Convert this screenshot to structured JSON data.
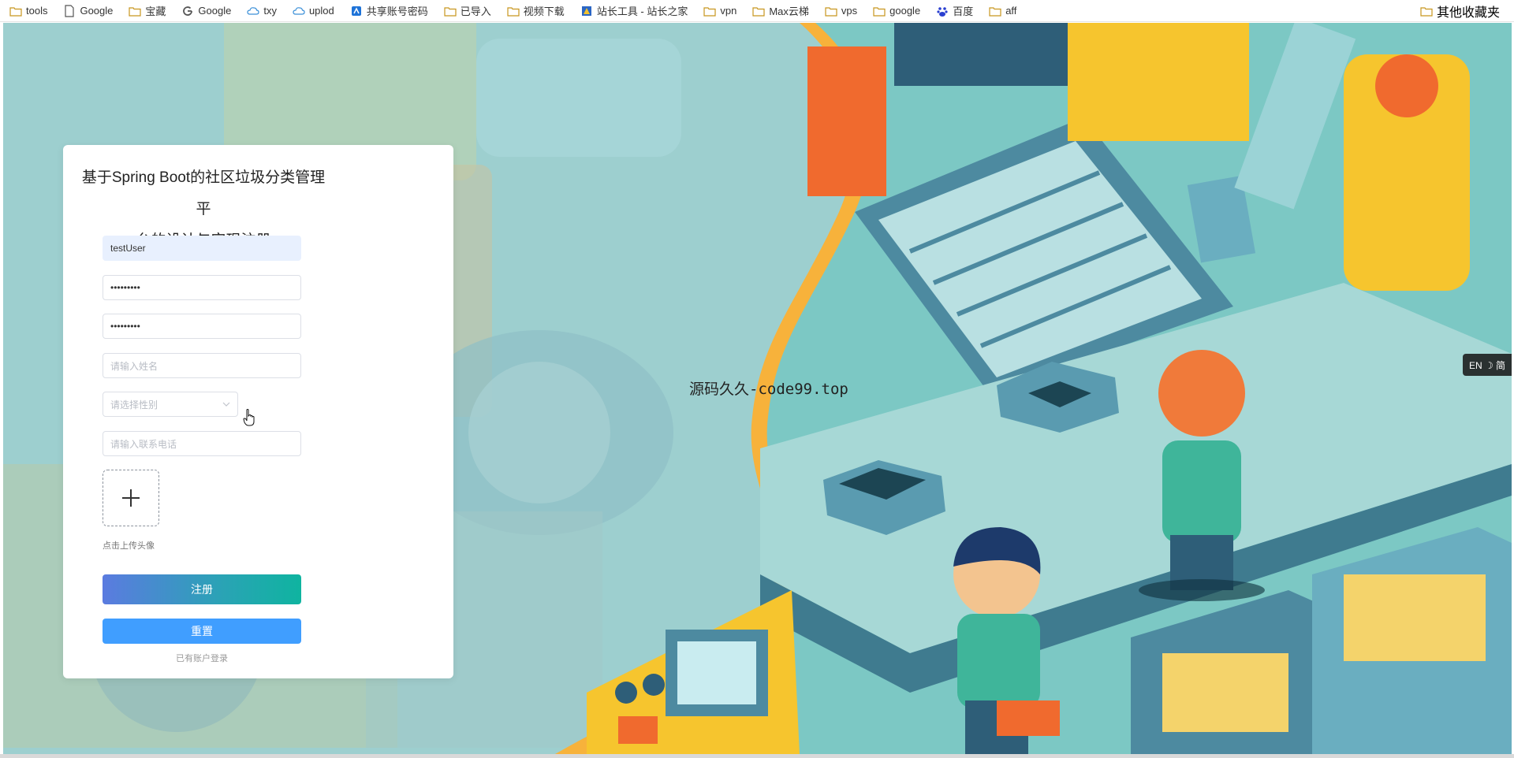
{
  "bookmarks": [
    {
      "label": "tools",
      "icon": "folder-icon"
    },
    {
      "label": "Google",
      "icon": "page-icon"
    },
    {
      "label": "宝藏",
      "icon": "folder-icon"
    },
    {
      "label": "Google",
      "icon": "google-icon"
    },
    {
      "label": "txy",
      "icon": "cloud-icon"
    },
    {
      "label": "uplod",
      "icon": "cloud-icon"
    },
    {
      "label": "共享账号密码",
      "icon": "app-icon"
    },
    {
      "label": "已导入",
      "icon": "folder-icon"
    },
    {
      "label": "视频下载",
      "icon": "folder-icon"
    },
    {
      "label": "站长工具 - 站长之家",
      "icon": "site-icon"
    },
    {
      "label": "vpn",
      "icon": "folder-icon"
    },
    {
      "label": "Max云梯",
      "icon": "folder-icon"
    },
    {
      "label": "vps",
      "icon": "folder-icon"
    },
    {
      "label": "google",
      "icon": "folder-icon"
    },
    {
      "label": "百度",
      "icon": "baidu-icon"
    },
    {
      "label": "aff",
      "icon": "folder-icon"
    }
  ],
  "bookmarks_other": "其他收藏夹",
  "register": {
    "title_line1": "基于Spring Boot的社区垃圾分类管理平",
    "title_line2": "台的设计与实现注册",
    "username_value": "testUser",
    "password_value": "•••••••••",
    "confirm_password_value": "•••••••••",
    "name_placeholder": "请输入姓名",
    "gender_placeholder": "请选择性别",
    "phone_placeholder": "请输入联系电话",
    "upload_hint": "点击上传头像",
    "register_button": "注册",
    "reset_button": "重置",
    "login_link": "已有账户登录"
  },
  "watermark": "源码久久-code99.top",
  "lang_toggle": "EN ☽ 简",
  "colors": {
    "register_gradient_start": "#5b7be0",
    "register_gradient_end": "#0fb4a0",
    "reset_blue": "#409eff",
    "autofill_bg": "#e8f0fe"
  }
}
